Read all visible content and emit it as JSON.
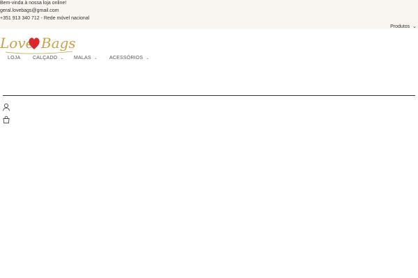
{
  "topbar": {
    "line1": "Bem-vinda à nossa loja online!",
    "line2": "geral.lovebags@gmail.com",
    "line3": "+351 913 340 712 - Rede móvel nacional",
    "products_label": "Produtos",
    "products_icon": "chevron-down-icon"
  },
  "logo": {
    "word1": "Love",
    "word2": "Bags",
    "heart_color": "#d9272e",
    "text_color": "#c9a24a"
  },
  "nav": {
    "items": [
      {
        "label": "LOJA",
        "has_dropdown": false
      },
      {
        "label": "CALÇADO",
        "has_dropdown": true
      },
      {
        "label": "MALAS",
        "has_dropdown": true
      },
      {
        "label": "ACESSÓRIOS",
        "has_dropdown": true
      }
    ]
  },
  "search": {
    "placeholder": ""
  },
  "icons": {
    "account": "user-icon",
    "cart": "shopping-bag-icon"
  }
}
